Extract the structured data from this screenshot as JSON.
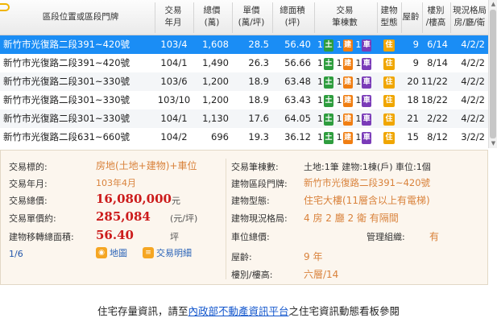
{
  "header": {
    "col_location": "區段位置或區段門牌",
    "col_date_top": "交易",
    "col_date_bot": "年月",
    "col_total_top": "總價",
    "col_total_bot": "(萬)",
    "col_unit_top": "單價",
    "col_unit_bot": "(萬/坪)",
    "col_area_top": "總面積",
    "col_area_bot": "(坪)",
    "col_count_top": "交易",
    "col_count_bot": "筆棟數",
    "col_type_top": "建物",
    "col_type_bot": "型態",
    "col_age": "屋齡",
    "col_floor_top": "樓別",
    "col_floor_bot": "/樓高",
    "col_layout_top": "現況格局",
    "col_layout_bot": "房/廳/衛"
  },
  "badges": {
    "land": "土",
    "building": "建",
    "car": "車",
    "type": "住"
  },
  "rows": [
    {
      "location": "新竹市光復路二段391~420號",
      "date": "103/4",
      "total": "1,608",
      "unit": "28.5",
      "area": "56.40",
      "land": "1",
      "building": "1",
      "car": "1",
      "age": "9",
      "floor": "6/14",
      "layout": "4/2/2"
    },
    {
      "location": "新竹市光復路二段391~420號",
      "date": "104/1",
      "total": "1,490",
      "unit": "26.3",
      "area": "56.66",
      "land": "1",
      "building": "1",
      "car": "1",
      "age": "9",
      "floor": "8/14",
      "layout": "4/2/2"
    },
    {
      "location": "新竹市光復路二段301~330號",
      "date": "103/6",
      "total": "1,200",
      "unit": "18.9",
      "area": "63.48",
      "land": "1",
      "building": "1",
      "car": "1",
      "age": "20",
      "floor": "11/22",
      "layout": "4/2/2"
    },
    {
      "location": "新竹市光復路二段301~330號",
      "date": "103/10",
      "total": "1,200",
      "unit": "18.9",
      "area": "63.43",
      "land": "1",
      "building": "1",
      "car": "1",
      "age": "18",
      "floor": "18/22",
      "layout": "4/2/2"
    },
    {
      "location": "新竹市光復路二段301~330號",
      "date": "104/1",
      "total": "1,130",
      "unit": "17.6",
      "area": "64.05",
      "land": "1",
      "building": "1",
      "car": "1",
      "age": "21",
      "floor": "2/22",
      "layout": "4/2/2"
    },
    {
      "location": "新竹市光復路二段631~660號",
      "date": "104/2",
      "total": "696",
      "unit": "19.3",
      "area": "36.12",
      "land": "1",
      "building": "1",
      "car": "1",
      "age": "15",
      "floor": "8/12",
      "layout": "3/2/2"
    }
  ],
  "detail": {
    "target_label": "交易標的:",
    "target_value": "房地(土地+建物)+車位",
    "ym_label": "交易年月:",
    "ym_value": "103年4月",
    "total_label": "交易總價:",
    "total_value": "16,080,000",
    "total_unit": "元",
    "unit_label": "交易單價約:",
    "unit_value": "285,084",
    "unit_unit": "(元/坪)",
    "area_label": "建物移轉總面積:",
    "area_value": "56.40",
    "area_unit": "坪",
    "nav": "1/6",
    "map_btn": "地圖",
    "detail_btn": "交易明細",
    "count_label": "交易筆棟數:",
    "count_value": "土地:1筆 建物:1棟(戶) 車位:1個",
    "addr_label": "建物區段門牌:",
    "addr_value": "新竹市光復路二段391~420號",
    "btype_label": "建物型態:",
    "btype_value": "住宅大樓(11層含以上有電梯)",
    "layout_label": "建物現況格局:",
    "layout_value": "4 房 2 廳 2 衛 有隔間",
    "parking_label": "車位總價:",
    "mgmt_label": "管理組織:",
    "mgmt_value": "有",
    "age_label": "屋齡:",
    "age_value": "9 年",
    "floor_label": "樓別/樓高:",
    "floor_value": "六層/14"
  },
  "footer": {
    "pre": "住宅存量資訊，請至",
    "link": "內政部不動產資訊平台",
    "post": "之住宅資訊動態看板參閱"
  },
  "colors": {
    "selected_row": "#1a8df5",
    "detail_bg": "#fcf6ee",
    "price_red": "#cc1b1b"
  }
}
